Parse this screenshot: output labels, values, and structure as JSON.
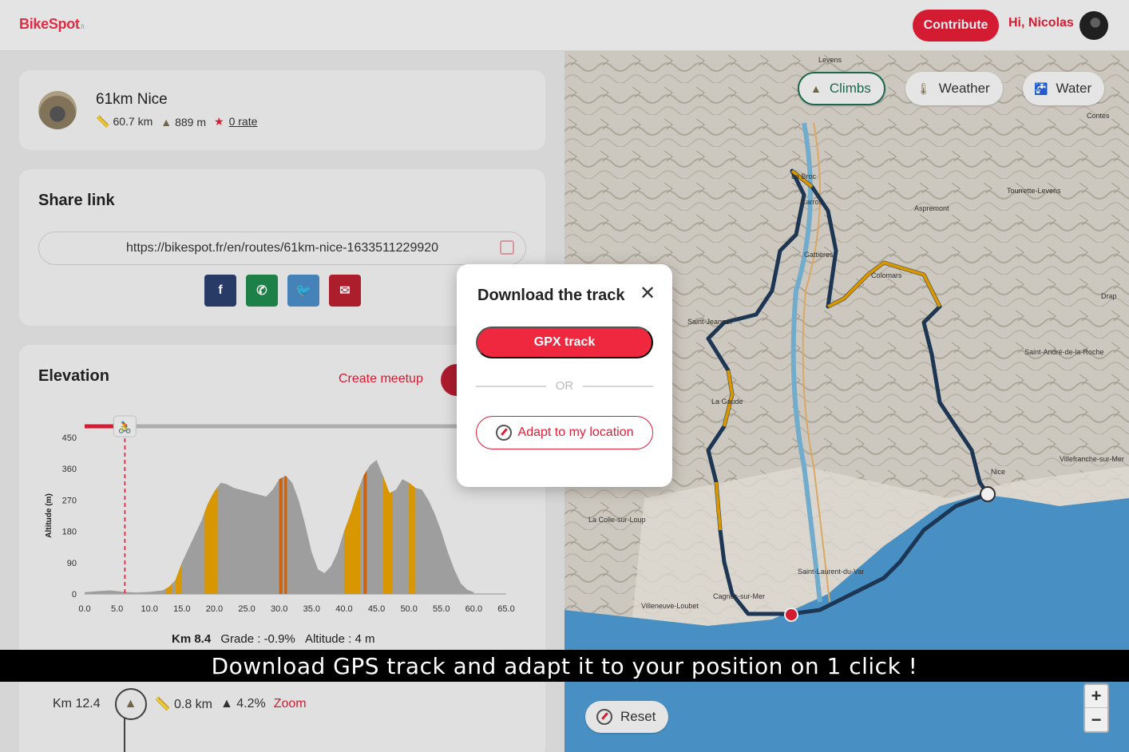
{
  "header": {
    "logo": "BikeSpot",
    "logo_suffix": ".fr",
    "contribute_label": "Contribute",
    "greeting": "Hi, Nicolas"
  },
  "route": {
    "title": "61km Nice",
    "distance": "60.7 km",
    "elevation": "889 m",
    "rating": "0 rate"
  },
  "share": {
    "title": "Share link",
    "url": "https://bikespot.fr/en/routes/61km-nice-1633511229920",
    "socials": [
      {
        "name": "facebook",
        "glyph": "f"
      },
      {
        "name": "whatsapp",
        "glyph": "✆"
      },
      {
        "name": "twitter",
        "glyph": "🐦"
      },
      {
        "name": "email",
        "glyph": "✉"
      }
    ]
  },
  "elevation": {
    "title": "Elevation",
    "create_meetup": "Create meetup",
    "readout": {
      "km": "Km 8.4",
      "grade": "Grade : -0.9%",
      "altitude": "Altitude : 4 m"
    }
  },
  "climb_row": {
    "km": "Km 12.4",
    "length": "0.8 km",
    "grade": "4.2%",
    "zoom": "Zoom"
  },
  "map": {
    "chips": {
      "climbs": "Climbs",
      "weather": "Weather",
      "water": "Water"
    },
    "reset": "Reset",
    "zoom_in": "+",
    "zoom_out": "−",
    "labels": [
      "Carros",
      "Saint-Jeannet",
      "La Gaude",
      "Nice",
      "Cagnes-sur-Mer",
      "Saint-Laurent-du-Var",
      "Villeneuve-Loubet",
      "La Colle-sur-Loup",
      "Aspremont",
      "Tourrette-Levens",
      "Saint-André-de-la-Roche",
      "Villefranche-sur-Mer",
      "Drap",
      "Contes",
      "Levens",
      "Le Broc",
      "Colomars",
      "Gattières"
    ]
  },
  "modal": {
    "title": "Download the track",
    "gpx_label": "GPX track",
    "or": "OR",
    "adapt_label": "Adapt to my location"
  },
  "banner": "Download GPS track and adapt it to your position on 1 click !",
  "chart_data": {
    "type": "area",
    "title": "",
    "xlabel": "",
    "ylabel": "Altitude (m)",
    "xlim": [
      0,
      65
    ],
    "ylim": [
      0,
      450
    ],
    "x_ticks": [
      "0.0",
      "5.0",
      "10.0",
      "15.0",
      "20.0",
      "25.0",
      "30.0",
      "35.0",
      "40.0",
      "45.0",
      "50.0",
      "55.0",
      "60.0",
      "65.0"
    ],
    "y_ticks": [
      "0",
      "90",
      "180",
      "270",
      "360",
      "450"
    ],
    "x": [
      0,
      2,
      4,
      6,
      8,
      10,
      12,
      13,
      14,
      15,
      16,
      17,
      18,
      19,
      20,
      21,
      22,
      23,
      24,
      25,
      26,
      27,
      28,
      29,
      30,
      31,
      32,
      33,
      34,
      35,
      36,
      37,
      38,
      39,
      40,
      41,
      42,
      43,
      44,
      45,
      46,
      47,
      48,
      49,
      50,
      51,
      52,
      53,
      54,
      55,
      56,
      57,
      58,
      59,
      60
    ],
    "y": [
      5,
      8,
      10,
      6,
      4,
      6,
      10,
      20,
      40,
      90,
      130,
      170,
      210,
      260,
      295,
      320,
      315,
      305,
      300,
      295,
      290,
      285,
      280,
      300,
      330,
      340,
      320,
      270,
      200,
      120,
      70,
      60,
      80,
      120,
      180,
      230,
      290,
      340,
      370,
      385,
      340,
      290,
      300,
      330,
      320,
      305,
      300,
      270,
      230,
      180,
      120,
      70,
      30,
      12,
      5
    ],
    "climb_segments_km": [
      [
        12.5,
        13.5
      ],
      [
        14.0,
        15.0
      ],
      [
        18.5,
        20.5
      ],
      [
        30.0,
        30.5
      ],
      [
        30.8,
        31.2
      ],
      [
        40.0,
        42.5
      ],
      [
        43.0,
        43.5
      ],
      [
        46.0,
        47.5
      ],
      [
        50.0,
        51.0
      ]
    ],
    "cursor_km": 6.2,
    "colors": {
      "area": "#a8a8a8",
      "climb": "#e6a100",
      "climb_steep": "#d86a10",
      "cursor": "#e11d35"
    }
  }
}
